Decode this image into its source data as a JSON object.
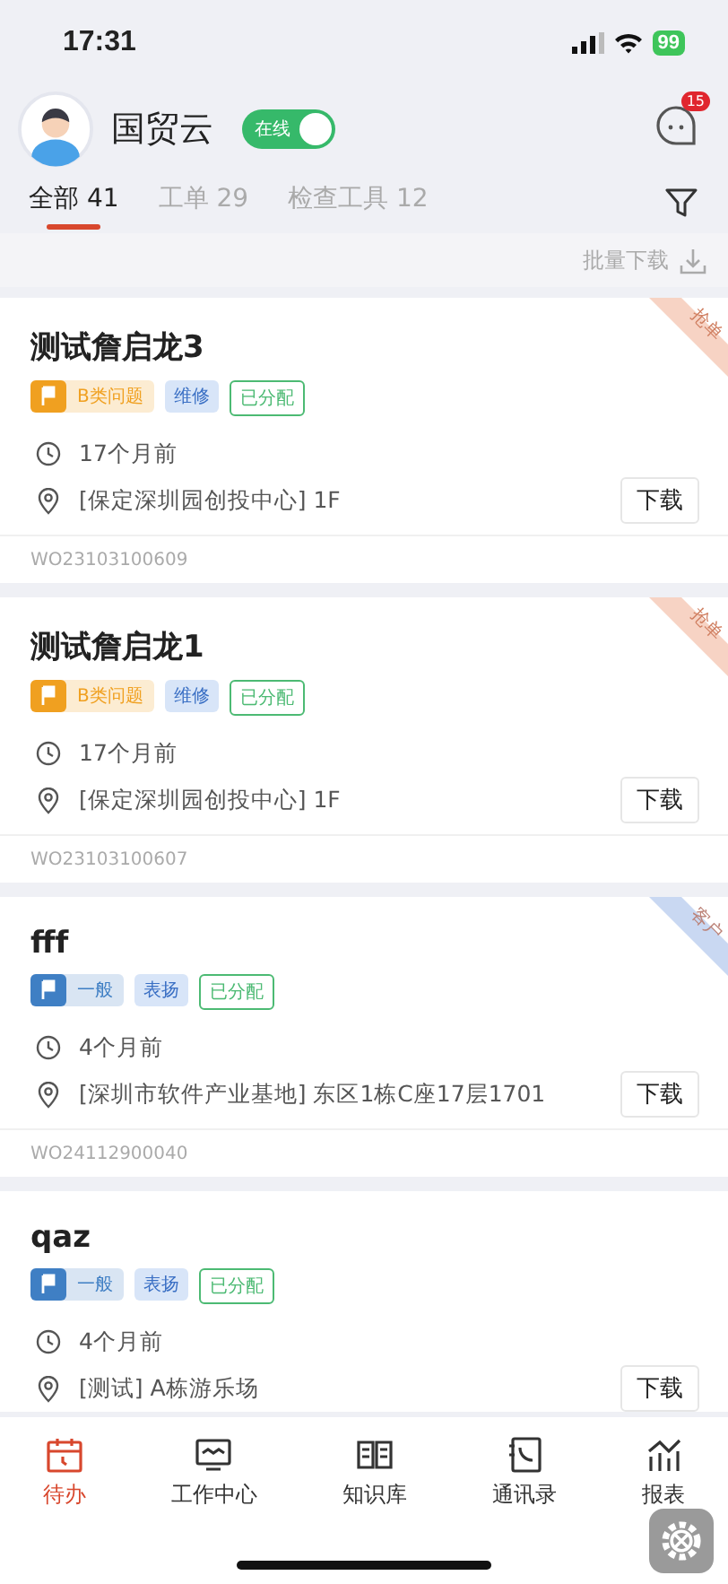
{
  "status_bar": {
    "time": "17:31",
    "battery": "99"
  },
  "header": {
    "name": "国贸云",
    "status_toggle": {
      "label": "在线",
      "on": true
    },
    "messages_badge": "15"
  },
  "tabs": [
    {
      "label": "全部 41",
      "selected": true
    },
    {
      "label": "工单 29",
      "selected": false
    },
    {
      "label": "检查工具 12",
      "selected": false
    }
  ],
  "batch_download": "批量下载",
  "orders": [
    {
      "title": "测试詹启龙3",
      "priority": {
        "label": "B类问题",
        "color": "#f0a020"
      },
      "type": "维修",
      "status": "已分配",
      "time": "17个月前",
      "location": "[保定深圳园创投中心] 1F",
      "action": "下载",
      "number": "WO23103100609",
      "ribbon": {
        "label": "抢单",
        "color": "#f7d3c4"
      }
    },
    {
      "title": "测试詹启龙1",
      "priority": {
        "label": "B类问题",
        "color": "#f0a020"
      },
      "type": "维修",
      "status": "已分配",
      "time": "17个月前",
      "location": "[保定深圳园创投中心] 1F",
      "action": "下载",
      "number": "WO23103100607",
      "ribbon": {
        "label": "抢单",
        "color": "#f7d3c4"
      }
    },
    {
      "title": "fff",
      "priority": {
        "label": "一般",
        "color": "#3f7fc4"
      },
      "type": "表扬",
      "status": "已分配",
      "time": "4个月前",
      "location": "[深圳市软件产业基地] 东区1栋C座17层1701",
      "action": "下载",
      "number": "WO24112900040",
      "ribbon": {
        "label": "客户",
        "color": "#c9d8f2"
      }
    },
    {
      "title": "qaz",
      "priority": {
        "label": "一般",
        "color": "#3f7fc4"
      },
      "type": "表扬",
      "status": "已分配",
      "time": "4个月前",
      "location": "[测试] A栋游乐场",
      "action": "下载"
    }
  ],
  "nav": [
    {
      "label": "待办",
      "selected": true
    },
    {
      "label": "工作中心",
      "selected": false
    },
    {
      "label": "知识库",
      "selected": false
    },
    {
      "label": "通讯录",
      "selected": false
    },
    {
      "label": "报表",
      "selected": false
    }
  ]
}
